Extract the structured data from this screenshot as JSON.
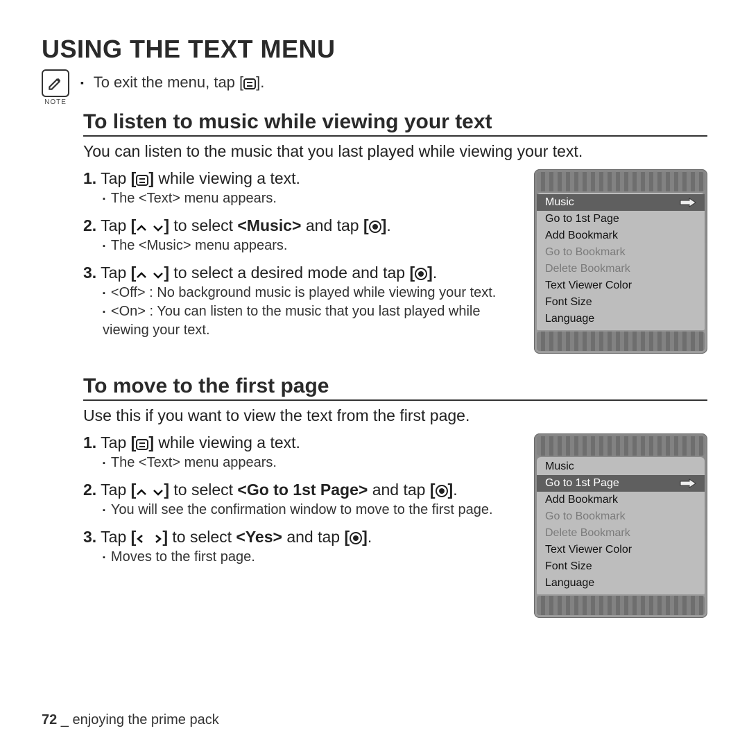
{
  "page": {
    "title": "USING THE TEXT MENU",
    "page_number": "72",
    "footer_sep": " _ ",
    "footer_text": "enjoying the prime pack"
  },
  "note": {
    "label": "NOTE",
    "text_a": "To exit the menu, tap [",
    "text_b": "]."
  },
  "sectionA": {
    "title": "To listen to music while viewing your text",
    "intro": "You can listen to the music that you last played while viewing your text.",
    "step1_num": "1.",
    "step1_a": " Tap ",
    "step1_b_open": "[",
    "step1_b_close": "]",
    "step1_c": " while viewing a text.",
    "step1_sub": "The <Text> menu appears.",
    "step2_num": "2.",
    "step2_a": " Tap ",
    "step2_b_open": "[",
    "step2_b_close": "]",
    "step2_c": " to select ",
    "step2_target": "<Music>",
    "step2_d": " and tap ",
    "step2_e_open": "[",
    "step2_e_close": "]",
    "step2_end": ".",
    "step2_sub": "The <Music> menu appears.",
    "step3_num": "3.",
    "step3_a": " Tap ",
    "step3_b_open": "[",
    "step3_b_close": "]",
    "step3_c": " to select a desired mode and tap ",
    "step3_d_open": "[",
    "step3_d_close": "]",
    "step3_end": ".",
    "step3_sub1": "<Off> : No background music is played while viewing your text.",
    "step3_sub2": "<On> : You can listen to the music that you last played while viewing your text."
  },
  "sectionB": {
    "title": "To move to the first page",
    "intro": "Use this if you want to view the text from the first page.",
    "step1_num": "1.",
    "step1_a": " Tap ",
    "step1_b_open": "[",
    "step1_b_close": "]",
    "step1_c": " while viewing a text.",
    "step1_sub": "The <Text> menu appears.",
    "step2_num": "2.",
    "step2_a": " Tap ",
    "step2_b_open": "[",
    "step2_b_close": "]",
    "step2_c": " to select ",
    "step2_target": "<Go to 1st Page>",
    "step2_d": " and tap ",
    "step2_e_open": "[",
    "step2_e_close": "]",
    "step2_end": ".",
    "step2_sub": "You will see the confirmation window to move to the first page.",
    "step3_num": "3.",
    "step3_a": " Tap ",
    "step3_b_open": "[",
    "step3_b_close": "]",
    "step3_c": " to select ",
    "step3_target": "<Yes>",
    "step3_d": " and tap ",
    "step3_e_open": "[",
    "step3_e_close": "]",
    "step3_end": ".",
    "step3_sub": "Moves to the first page."
  },
  "menu_items": {
    "music": "Music",
    "goto1st": "Go to 1st Page",
    "addbm": "Add Bookmark",
    "gotobm": "Go to Bookmark",
    "delbm": "Delete Bookmark",
    "tvc": "Text Viewer Color",
    "fs": "Font Size",
    "lang": "Language"
  }
}
